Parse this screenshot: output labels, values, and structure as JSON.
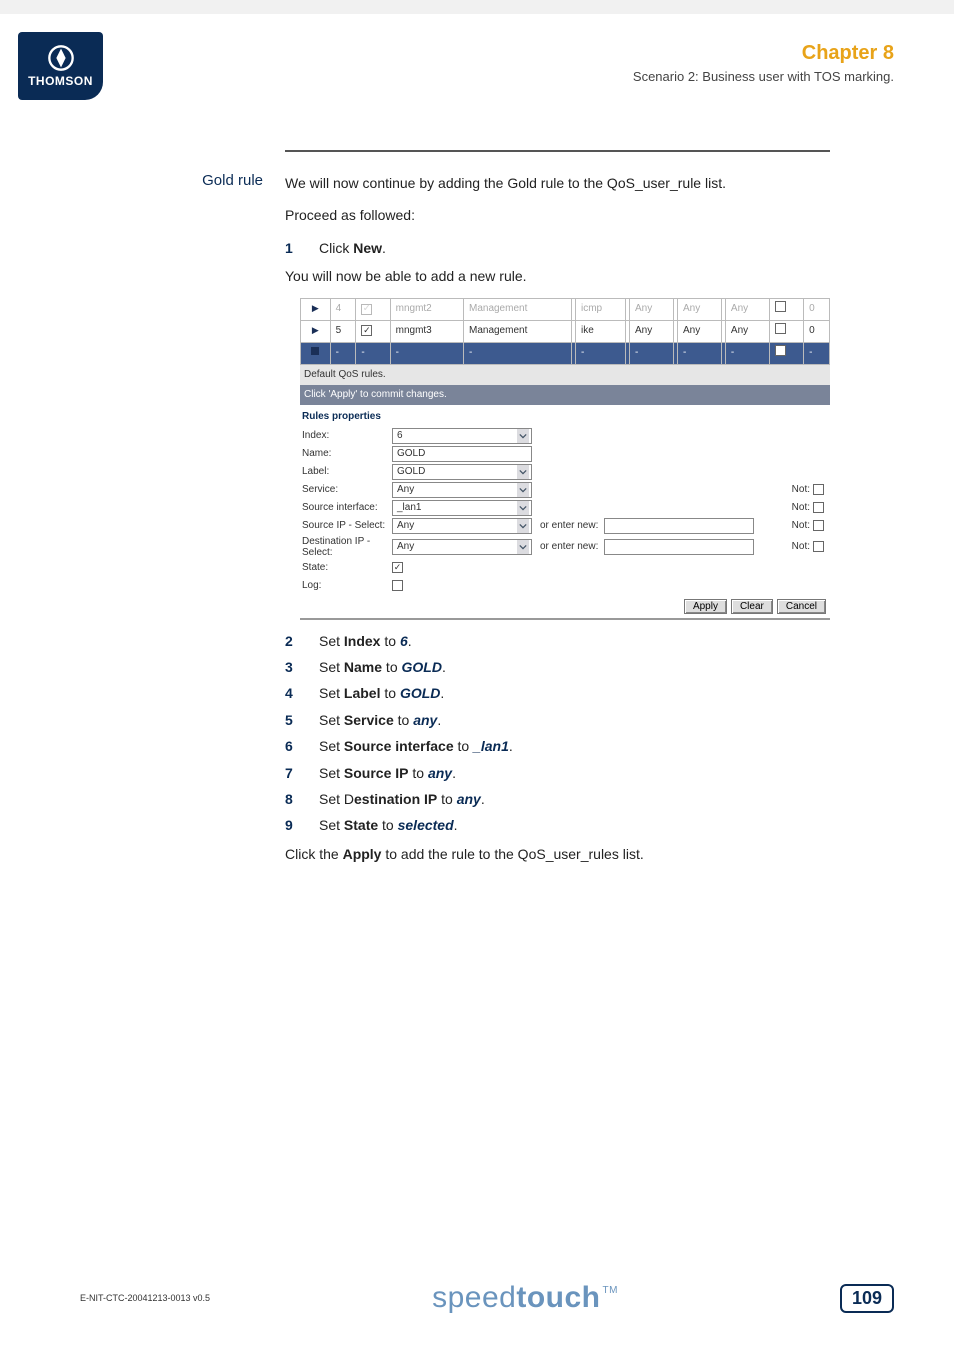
{
  "header": {
    "logo_text": "THOMSON",
    "chapter": "Chapter 8",
    "scenario": "Scenario 2: Business user with TOS marking."
  },
  "section": {
    "label": "Gold rule",
    "intro": "We will now continue by adding the Gold rule to the QoS_user_rule list.",
    "proceed": "Proceed as followed:",
    "step1_pre": "Click ",
    "step1_bold": "New",
    "step1_post": ".",
    "after1": "You will now be able to add a new rule.",
    "closing_pre": "Click the ",
    "closing_bold": "Apply",
    "closing_post": " to add the rule to the QoS_user_rules list."
  },
  "steps": [
    {
      "n": "2",
      "pre": "Set ",
      "bold": "Index",
      "mid": " to ",
      "val": "6",
      "post": "."
    },
    {
      "n": "3",
      "pre": "Set ",
      "bold": "Name",
      "mid": " to ",
      "val": "GOLD",
      "post": "."
    },
    {
      "n": "4",
      "pre": "Set ",
      "bold": "Label",
      "mid": " to ",
      "val": "GOLD",
      "post": "."
    },
    {
      "n": "5",
      "pre": "Set ",
      "bold": "Service",
      "mid": " to ",
      "val": "any",
      "post": "."
    },
    {
      "n": "6",
      "pre": "Set ",
      "bold": "Source interface",
      "mid": " to ",
      "val": "_lan1",
      "post": "."
    },
    {
      "n": "7",
      "pre": "Set ",
      "bold": "Source IP",
      "mid": " to ",
      "val": "any",
      "post": "."
    },
    {
      "n": "8",
      "pre": "Set D",
      "bold": "estination IP",
      "mid": " to ",
      "val": "any",
      "post": "."
    },
    {
      "n": "9",
      "pre": "Set ",
      "bold": "State",
      "mid": " to ",
      "val": "selected",
      "post": "."
    }
  ],
  "ui": {
    "rows": [
      {
        "sel": "▶",
        "idx": "4",
        "chk": true,
        "chkFaded": true,
        "name": "mngmt2",
        "label": "Management",
        "svc": "icmp",
        "c1": "Any",
        "c2": "Any",
        "c3": "Any",
        "log": false,
        "o": "0",
        "faded": true
      },
      {
        "sel": "▶",
        "idx": "5",
        "chk": true,
        "chkFaded": false,
        "name": "mngmt3",
        "label": "Management",
        "svc": "ike",
        "c1": "Any",
        "c2": "Any",
        "c3": "Any",
        "log": false,
        "o": "0",
        "faded": false
      },
      {
        "sel": "■",
        "idx": "-",
        "chk": false,
        "chkFaded": false,
        "name": "-",
        "label": "-",
        "svc": "-",
        "c1": "-",
        "c2": "-",
        "c3": "-",
        "log": false,
        "o": "-",
        "faded": false,
        "selected": true
      }
    ],
    "bar1": "Default QoS rules.",
    "bar2": "Click 'Apply' to commit changes.",
    "props_title": "Rules properties",
    "fields": {
      "index_lbl": "Index:",
      "index_val": "6",
      "name_lbl": "Name:",
      "name_val": "GOLD",
      "label_lbl": "Label:",
      "label_val": "GOLD",
      "service_lbl": "Service:",
      "service_val": "Any",
      "srcif_lbl": "Source interface:",
      "srcif_val": "_lan1",
      "srcip_lbl": "Source IP - Select:",
      "srcip_val": "Any",
      "dstip_lbl": "Destination IP - Select:",
      "dstip_val": "Any",
      "state_lbl": "State:",
      "log_lbl": "Log:",
      "or_enter": "or enter new:",
      "not": "Not:",
      "apply": "Apply",
      "clear": "Clear",
      "cancel": "Cancel"
    }
  },
  "footer": {
    "docid": "E-NIT-CTC-20041213-0013 v0.5",
    "brand_light": "speed",
    "brand_bold": "touch",
    "tm": "TM",
    "page": "109"
  }
}
